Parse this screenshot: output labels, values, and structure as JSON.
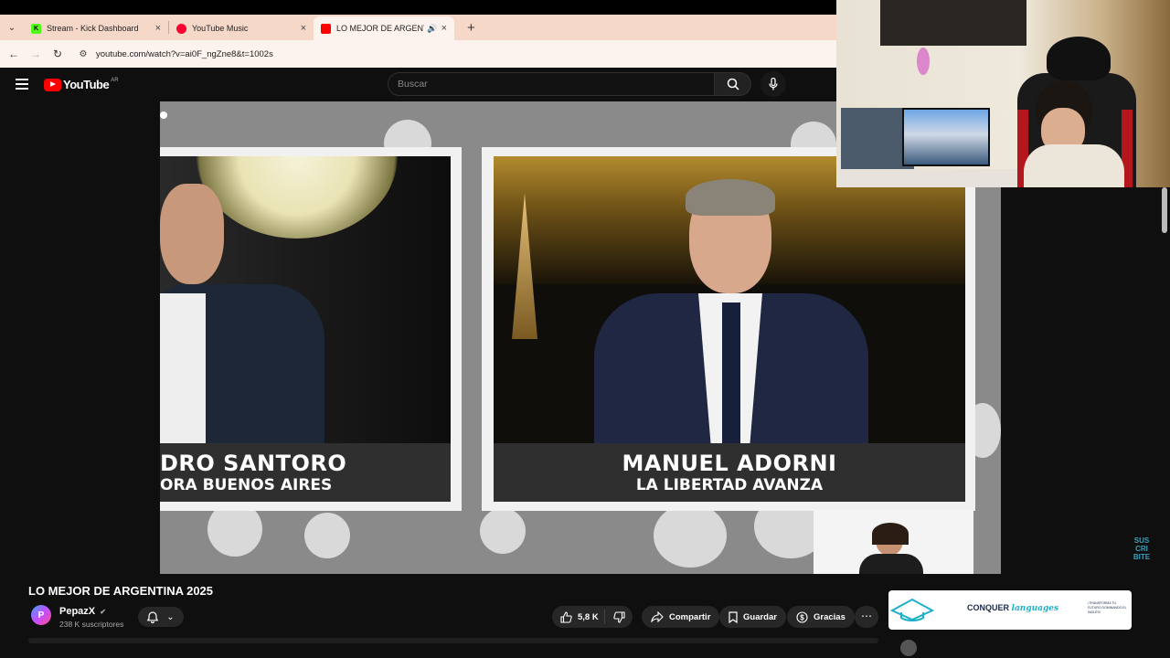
{
  "browser": {
    "tabs": [
      {
        "label": "Stream - Kick Dashboard",
        "favicon_color": "#53fc18"
      },
      {
        "label": "YouTube Music",
        "favicon_color": "#ff0033"
      },
      {
        "label": "LO MEJOR DE ARGENTINA",
        "favicon_color": "#ff0000",
        "active": true
      }
    ],
    "url": "youtube.com/watch?v=ai0F_ngZne8&t=1002s"
  },
  "header": {
    "logo_text": "YouTube",
    "country": "AR",
    "search_placeholder": "Buscar"
  },
  "video": {
    "captions": [
      {
        "name": "DRO SANTORO",
        "party": "ORA BUENOS AIRES"
      },
      {
        "name": "MANUEL ADORNI",
        "party": "LA LIBERTAD AVANZA"
      }
    ]
  },
  "watch": {
    "title": "LO MEJOR DE ARGENTINA 2025",
    "channel": {
      "name": "PepazX",
      "subscribers": "238 K suscriptores"
    },
    "actions": {
      "likes": "5,8 K",
      "share": "Compartir",
      "save": "Guardar",
      "thanks": "Gracias"
    }
  },
  "ad": {
    "brand_main": "CONQUER",
    "brand_sub": "languages",
    "tagline": "¡TRANSFORMA TU FUTURO DOMINANDO EL INGLÉS!"
  },
  "overlay": {
    "subscribe_badge": "SUS CRI BITE"
  }
}
